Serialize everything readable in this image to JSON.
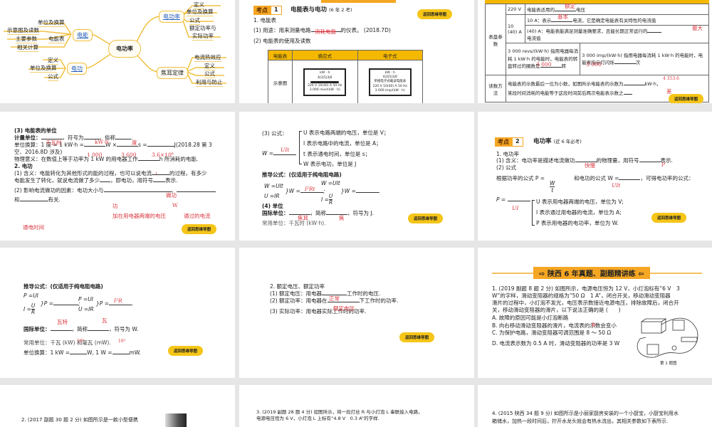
{
  "back_label": "返回思维导图",
  "s1": {
    "center": "电功率",
    "power": "电功率",
    "power_leaves": [
      "定义",
      "单位及换算",
      "公式",
      "额定功率与",
      "实际功率"
    ],
    "energy": "电能",
    "energy_leaves": [
      "单位及换算",
      "示意图及读数",
      "主要参数",
      "电能表",
      "相关计算"
    ],
    "work": "电功",
    "work_leaves": [
      "定义",
      "单位及换算",
      "公式"
    ],
    "joule": "焦耳定律",
    "joule_leaves": [
      "电流热效应",
      "定义",
      "公式",
      "利用与防止"
    ]
  },
  "s2": {
    "badge_k": "考点",
    "badge_n": "1",
    "title": "电能表与电功",
    "title_note": "(6 年 2 考)",
    "l1": "1. 电能表",
    "l2": "(1) 用途：用来测量电路",
    "l2b": "的仪表。 (2018.7D)",
    "a1": "消耗电能",
    "l3": "(2) 电能表的使用及读数",
    "th": [
      "电能表",
      "感应式",
      "电子式"
    ],
    "row": "示意图",
    "meter_unit": "kW · h",
    "digits": [
      "4",
      "3",
      "5",
      "3",
      "6"
    ],
    "m1_l1": "220 V 10(40) A 50 Hz",
    "m1_l2": "3 000 revs/(kW · h)",
    "m2_l0": "单相电子式载波电能表",
    "m2_l1": "220 V 10(40) A 50 Hz",
    "m2_l2": "3 000 imp/(kW · h)"
  },
  "s3": {
    "param": "表盘参数",
    "v": "220 V",
    "v_text": "电能表适用的",
    "v_end": "电压",
    "v_ans": "额定",
    "a": "10 (40) A",
    "a1": "10 A：表示",
    "a1_end": "电流，它是确定电能表有关特性的电流值",
    "a1_ans": "基本",
    "a2": "(40) A：电能表能满足测量准确要求，且能长期正常运行的",
    "a2_end": "电流值",
    "a2_ans": "最大",
    "rev": "3 000 revs/(kW·h) 指用电器每消耗 1 kW·h 的电能时，电能表的转盘转过的圈数是",
    "rev_end": "转",
    "rev_ans": "3 000",
    "imp": "3 000 imp/(kW·h) 指用电器每消耗 1 kW·h 的电能时，电能表指示灯闪烁",
    "imp_end": "次",
    "imp_ans": "3 000",
    "read": "读数方法",
    "read1": "电能表的示数最后一位为小数，如图所示电能表的示数为",
    "read1_end": "kW·h，",
    "read1_ans": "4 353.6",
    "read2": "某段时间消耗的电能等于这段时间前后两次电能表示数之",
    "read2_ans": "差"
  },
  "s4": {
    "l1": "(3) 电能表的单位",
    "l2": "计量单位：",
    "l2b": "，符号为",
    "l2c": "，俗称",
    "l3": "单位换算：1 度 = 1 kW·h =",
    "l3b": "W ×",
    "l3c": "s =",
    "l3d": "J(2018.28 第 3",
    "l4": "空、2016.8D 涉及)",
    "l5": "物理意义：在数值上等于功率为 1 kW 的用电器工作",
    "l5b": "h 所消耗的电能.",
    "l6": "2. 电功",
    "l7": "(1) 含义：电能转化为其他形式的能的过程，也可以说电流",
    "l7b": "的过程，有多少",
    "l8": "电能发生了转化，就说电流做了多少",
    "l8b": "，即电功，用符号",
    "l8c": "表示.",
    "l9": "(2) 影响电流做功的因素：电功大小与",
    "l10": "和",
    "l10b": "有关.",
    "ans": [
      "千瓦时",
      "kW·h",
      "度",
      "1 000",
      "3 600",
      "3.6×10⁶",
      "1",
      "做功",
      "功",
      "W",
      "加在用电器两端的电压",
      "通过的电流",
      "通电时间"
    ]
  },
  "s5": {
    "l1": "(3) 公式：",
    "w": "W =",
    "w_ans": "UIt",
    "b1": "U 表示电路两端的电压，单位是 V；",
    "b2": "I 表示电路中的电流，单位是 A；",
    "b3": "t 表示通电时间，单位是 s；",
    "b4": "W 表示电功，单位是 J",
    "d": "推导公式：(仅适用于纯电阻电路)",
    "f1": "W =UIt",
    "f2": "U =IR",
    "f3": "W =",
    "f3_ans": "I²Rt",
    "f4": "W =UIt",
    "f5": "I =",
    "f5n": "U",
    "f5d": "R",
    "f6": "W =",
    "unit": "(4) 单位",
    "si": "国际单位：",
    "si_b": "，简称",
    "si_c": "，符号为 J.",
    "si_ans": [
      "焦耳",
      "焦"
    ],
    "common": "常用单位：千瓦时 (kW·h)."
  },
  "s6": {
    "badge_k": "考点",
    "badge_n": "2",
    "title": "电功率",
    "title_note": "(近 6 年必考)",
    "l1": "1. 电功率",
    "l2": "(1) 含义：电功率是描述电流做功",
    "l2b": "的物理量，用符号",
    "l2c": "表示.",
    "l3": "(2) 公式",
    "l4": "根据功率的公式 P =",
    "l4b": "和电功的公式 W =",
    "l4c": "，可得电功率的公式：",
    "frac_n": "W",
    "frac_d": "t",
    "p": "P =",
    "ans": [
      "快慢",
      "P",
      "UIt",
      "UI"
    ],
    "b1": "U 表示用电器两端的电压，单位为 V;",
    "b2": "I 表示通过用电器的电流，单位为 A;",
    "b3": "P 表示用电器的电功率，单位为 W."
  },
  "s7": {
    "d": "推导公式：(仅适用于纯电阻电路)",
    "f1": "P =UI",
    "f2": "I =",
    "f2n": "U",
    "f2d": "R",
    "f3": "P =",
    "f4": "P =UI",
    "f5": "U =IR",
    "f6": "P =",
    "f6_ans": "I²R",
    "si": "国际单位：",
    "si_b": "，简称",
    "si_c": "，符号为 W.",
    "si_ans": [
      "瓦特",
      "瓦"
    ],
    "common": "常用单位：千瓦 (kW) 和毫瓦 (mW).",
    "common_ans": [
      "10³",
      "10³"
    ],
    "conv": "单位换算：1 kW =",
    "conv_b": "W, 1 W =",
    "conv_c": "mW."
  },
  "s8": {
    "l1": "2. 额定电压、额定功率",
    "l2": "(1) 额定电压：用电器",
    "l2b": "工作时的电压.",
    "l3": "(2) 额定功率：用电器在",
    "l3b": "下工作时的功率.",
    "l4": "(3) 实际功率：用电器实际工作时的功率.",
    "ans": [
      "正常",
      "额定电压"
    ]
  },
  "s9": {
    "section": "陕西 6 年真题、副题精讲练",
    "q": "1. (2019 副题 8 题 2 分) 如图所示，电源电压恒为 12 V，小灯泡标有“6 V　3",
    "q2": "W”的字样，滑动变阻器的规格为“50 Ω　1 A”，闭合开关，移动滑动变阻器",
    "q3": "滑片的过程中，小灯泡不发光，电压表示数接近电源电压，排除故障后，闭合开",
    "q4": "关，移动滑动变阻器的滑片，以下说法正确的是 (　　)",
    "A": "A. 故障的原因可能是小灯泡断路",
    "B": "B. 向右移动滑动变阻器的滑片，电流表的示数会变小",
    "C": "C. 为保护电路，滑动变阻器可调范围是 8 ～ 50 Ω",
    "D": "D. 电流表示数为 0.5 A 时，滑动变阻器的功率是 3 W",
    "fig": "第 1 题图",
    "ans": "B"
  },
  "s10": {
    "q": "2. (2017 副题 30 题 2 分) 如图所示是一款小型便携"
  },
  "s11": {
    "q": "3. (2019 副题 28 题 4 分) 如图所示，将一段灯丝 R 与小灯泡 L 串联接入电路，",
    "q2": "电源电压恒为 6 V，小灯泡 L 上标有“4.8 V　0.3 A”的字样."
  },
  "s12": {
    "q": "4. (2015 陕西 34 题 9 分) 如图所示是小丽家厨房安装的一个小厨宝，小厨宝利用水",
    "q2": "箱储水，加热一段时间后，拧开水龙头就会有热水流出，其相关参数如下表所示."
  }
}
